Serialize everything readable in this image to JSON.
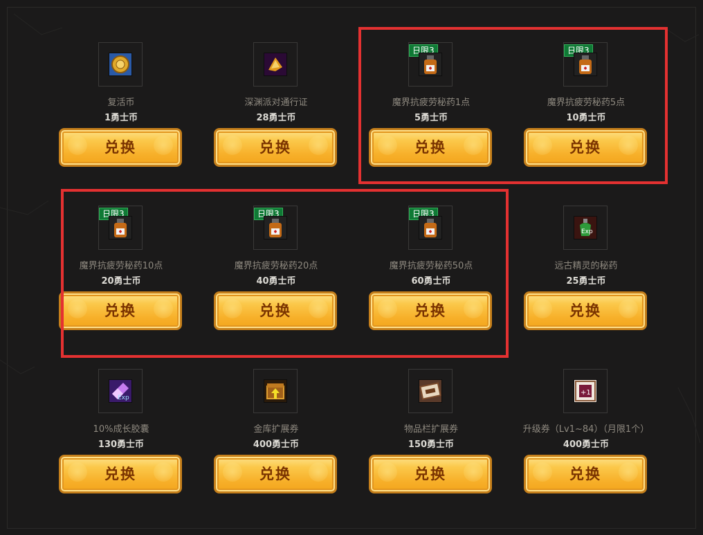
{
  "button_label": "兑换",
  "items": [
    {
      "name": "复活币",
      "price": "1勇士币",
      "badge": "",
      "icon": "revive-coin-icon"
    },
    {
      "name": "深渊派对通行证",
      "price": "28勇士币",
      "badge": "",
      "icon": "abyss-party-pass-icon"
    },
    {
      "name": "魔界抗疲劳秘药1点",
      "price": "5勇士币",
      "badge": "日限3",
      "icon": "fatigue-potion-icon"
    },
    {
      "name": "魔界抗疲劳秘药5点",
      "price": "10勇士币",
      "badge": "日限3",
      "icon": "fatigue-potion-icon"
    },
    {
      "name": "魔界抗疲劳秘药10点",
      "price": "20勇士币",
      "badge": "日限3",
      "icon": "fatigue-potion-icon"
    },
    {
      "name": "魔界抗疲劳秘药20点",
      "price": "40勇士币",
      "badge": "日限3",
      "icon": "fatigue-potion-icon"
    },
    {
      "name": "魔界抗疲劳秘药50点",
      "price": "60勇士币",
      "badge": "日限3",
      "icon": "fatigue-potion-icon"
    },
    {
      "name": "远古精灵的秘药",
      "price": "25勇士币",
      "badge": "",
      "icon": "exp-potion-icon"
    },
    {
      "name": "10%成长胶囊",
      "price": "130勇士币",
      "badge": "",
      "icon": "growth-capsule-icon"
    },
    {
      "name": "金库扩展券",
      "price": "400勇士币",
      "badge": "",
      "icon": "vault-expansion-icon"
    },
    {
      "name": "物品栏扩展券",
      "price": "150勇士币",
      "badge": "",
      "icon": "inventory-expansion-icon"
    },
    {
      "name": "升级券（Lv1~84）（月限1个）",
      "price": "400勇士币",
      "badge": "",
      "icon": "level-up-ticket-icon"
    }
  ],
  "colors": {
    "highlight": "#e43131",
    "badge": "#0f7a35",
    "button": "#f7b02a"
  }
}
